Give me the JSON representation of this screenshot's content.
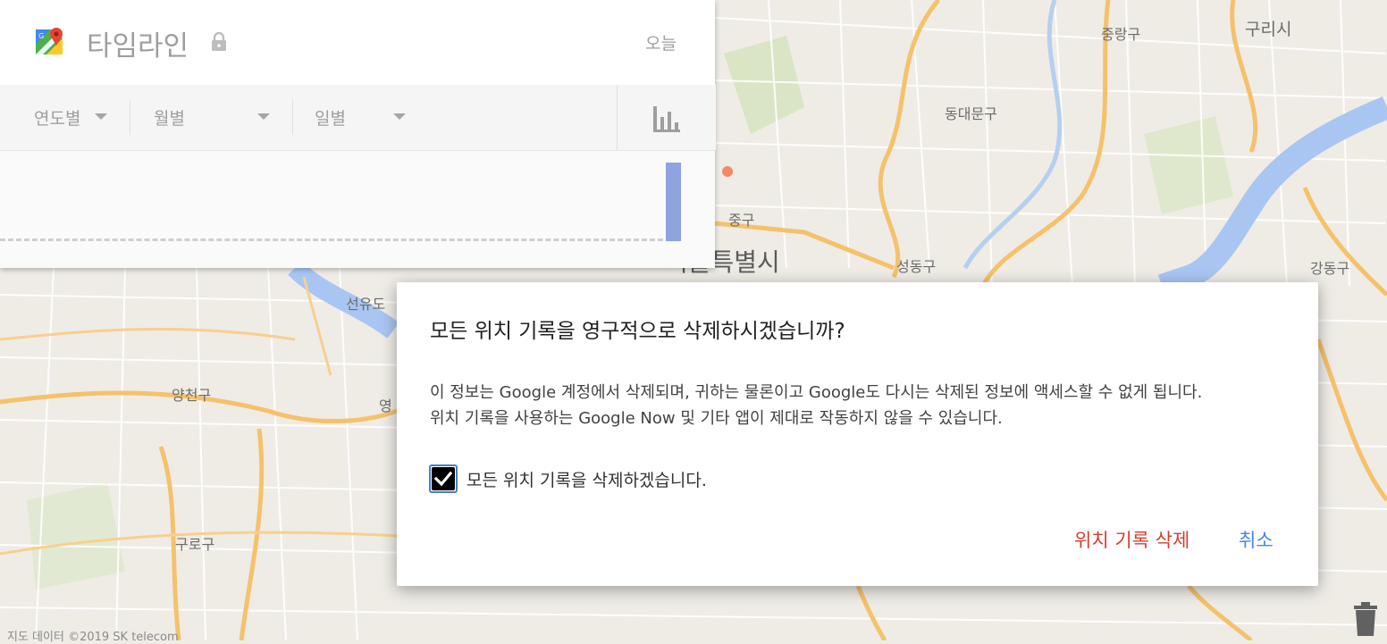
{
  "map": {
    "labels": {
      "jungnang": "중랑구",
      "guri": "구리시",
      "dongdaemun": "동대문구",
      "junggu": "중구",
      "seoul_city": "서울특별시",
      "seongdong": "성동구",
      "gangdong": "강동구",
      "seonyudo": "선유도",
      "yangcheon": "양천구",
      "yeong": "영",
      "guro": "구로구"
    },
    "copyright": "지도 데이터 ©2019 SK telecom",
    "colors": {
      "road": "#f5c26b",
      "river": "#a9c6f2",
      "land": "#efece6"
    }
  },
  "timeline": {
    "title": "타임라인",
    "logo_icon": "google-maps-icon",
    "lock_icon": "lock-icon",
    "today": "오늘",
    "filters": [
      {
        "label": "연도별",
        "icon": "caret-down-icon"
      },
      {
        "label": "월별",
        "icon": "caret-down-icon"
      },
      {
        "label": "일별",
        "icon": "caret-down-icon"
      }
    ],
    "chart_icon": "bar-chart-icon",
    "bar_color": "#8fa3de"
  },
  "dialog": {
    "title": "모든 위치 기록을 영구적으로 삭제하시겠습니까?",
    "message_line1": "이 정보는 Google 계정에서 삭제되며, 귀하는 물론이고 Google도 다시는 삭제된 정보에 액세스할 수 없게 됩니다.",
    "message_line2": "위치 기록을 사용하는 Google Now 및 기타 앱이 제대로 작동하지 않을 수 있습니다.",
    "confirm_label": "모든 위치 기록을 삭제하겠습니다.",
    "confirm_checked": true,
    "delete_label": "위치 기록 삭제",
    "cancel_label": "취소",
    "colors": {
      "delete": "#d23f31",
      "cancel": "#4285f4"
    }
  },
  "trash_icon": "trash-icon"
}
